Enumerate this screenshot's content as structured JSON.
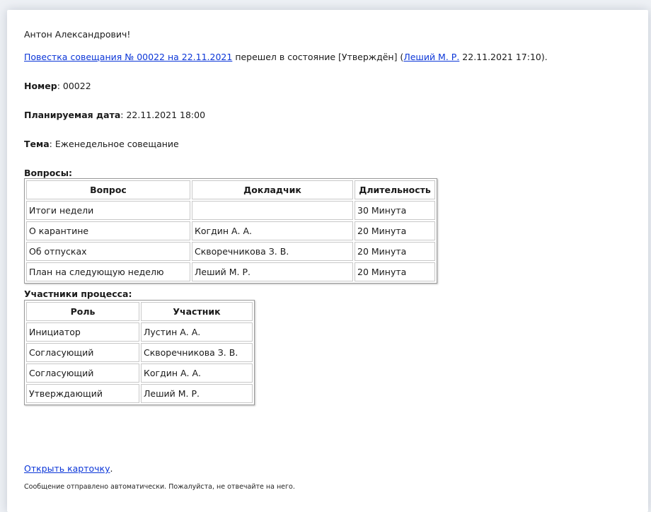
{
  "email": {
    "greeting": "Антон Александрович!",
    "status_link": "Повестка совещания № 00022 на 22.11.2021",
    "status_text_1": " перешел в состояние [Утверждён] (",
    "status_user_link": "Леший М. Р.",
    "status_text_2": " 22.11.2021 17:10).",
    "number_label": "Номер",
    "number_value": ": 00022",
    "date_label": "Планируемая дата",
    "date_value": ": 22.11.2021 18:00",
    "topic_label": "Тема",
    "topic_value": ": Еженедельное совещание",
    "questions_heading": "Вопросы:",
    "questions_table": {
      "headers": [
        "Вопрос",
        "Докладчик",
        "Длительность"
      ],
      "rows": [
        [
          "Итоги недели",
          "",
          "30 Минута"
        ],
        [
          "О карантине",
          "Когдин А. А.",
          "20 Минута"
        ],
        [
          "Об отпусках",
          "Скворечникова З. В.",
          "20 Минута"
        ],
        [
          "План на следующую неделю",
          "Леший М. Р.",
          "20 Минута"
        ]
      ]
    },
    "participants_heading": "Участники процесса:",
    "participants_table": {
      "headers": [
        "Роль",
        "Участник"
      ],
      "rows": [
        [
          "Инициатор",
          "Лустин А. А."
        ],
        [
          "Согласующий",
          "Скворечникова З. В."
        ],
        [
          "Согласующий",
          "Когдин А. А."
        ],
        [
          "Утверждающий",
          "Леший М. Р."
        ]
      ]
    },
    "open_card_link": "Открыть карточку",
    "open_card_suffix": ".",
    "footer_note": "Сообщение отправлено автоматически. Пожалуйста, не отвечайте на него."
  },
  "colors": {
    "link": "#0b36d8",
    "background": "#eef1f5",
    "card": "#ffffff"
  }
}
